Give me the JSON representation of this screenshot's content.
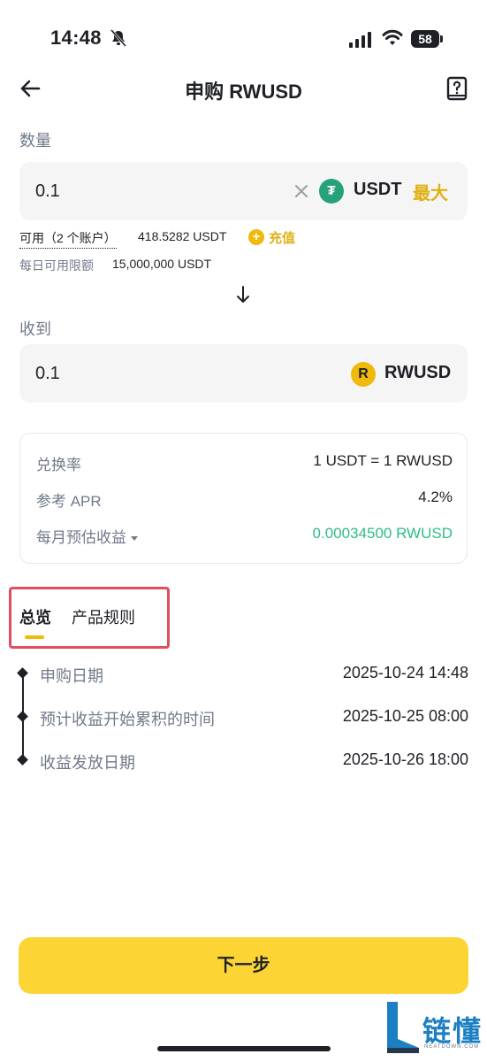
{
  "status_bar": {
    "time": "14:48",
    "battery": "58"
  },
  "header": {
    "title": "申购 RWUSD"
  },
  "quantity": {
    "label": "数量",
    "value": "0.1",
    "coin": "USDT",
    "coin_glyph": "₮",
    "max": "最大",
    "available_label": "可用（2 个账户）",
    "available_amount": "418.5282 USDT",
    "deposit": "充值",
    "limit_label": "每日可用限额",
    "limit_value": "15,000,000 USDT"
  },
  "receive": {
    "label": "收到",
    "value": "0.1",
    "coin": "RWUSD",
    "coin_glyph": "R"
  },
  "info": {
    "rate_label": "兑换率",
    "rate_value": "1 USDT = 1 RWUSD",
    "apr_label": "参考 APR",
    "apr_value": "4.2%",
    "monthly_label": "每月预估收益",
    "monthly_value": "0.00034500 RWUSD"
  },
  "tabs": [
    {
      "label": "总览"
    },
    {
      "label": "产品规则"
    }
  ],
  "timeline": [
    {
      "label": "申购日期",
      "value": "2025-10-24 14:48"
    },
    {
      "label": "预计收益开始累积的时间",
      "value": "2025-10-25 08:00"
    },
    {
      "label": "收益发放日期",
      "value": "2025-10-26 18:00"
    }
  ],
  "next_button": "下一步",
  "watermark": {
    "text": "链懂",
    "sub": "NEATDOWN.COM"
  },
  "colors": {
    "accent": "#fcd535",
    "brand_text": "#e0b012",
    "green": "#2ebd85",
    "highlight": "#e04f5f"
  }
}
